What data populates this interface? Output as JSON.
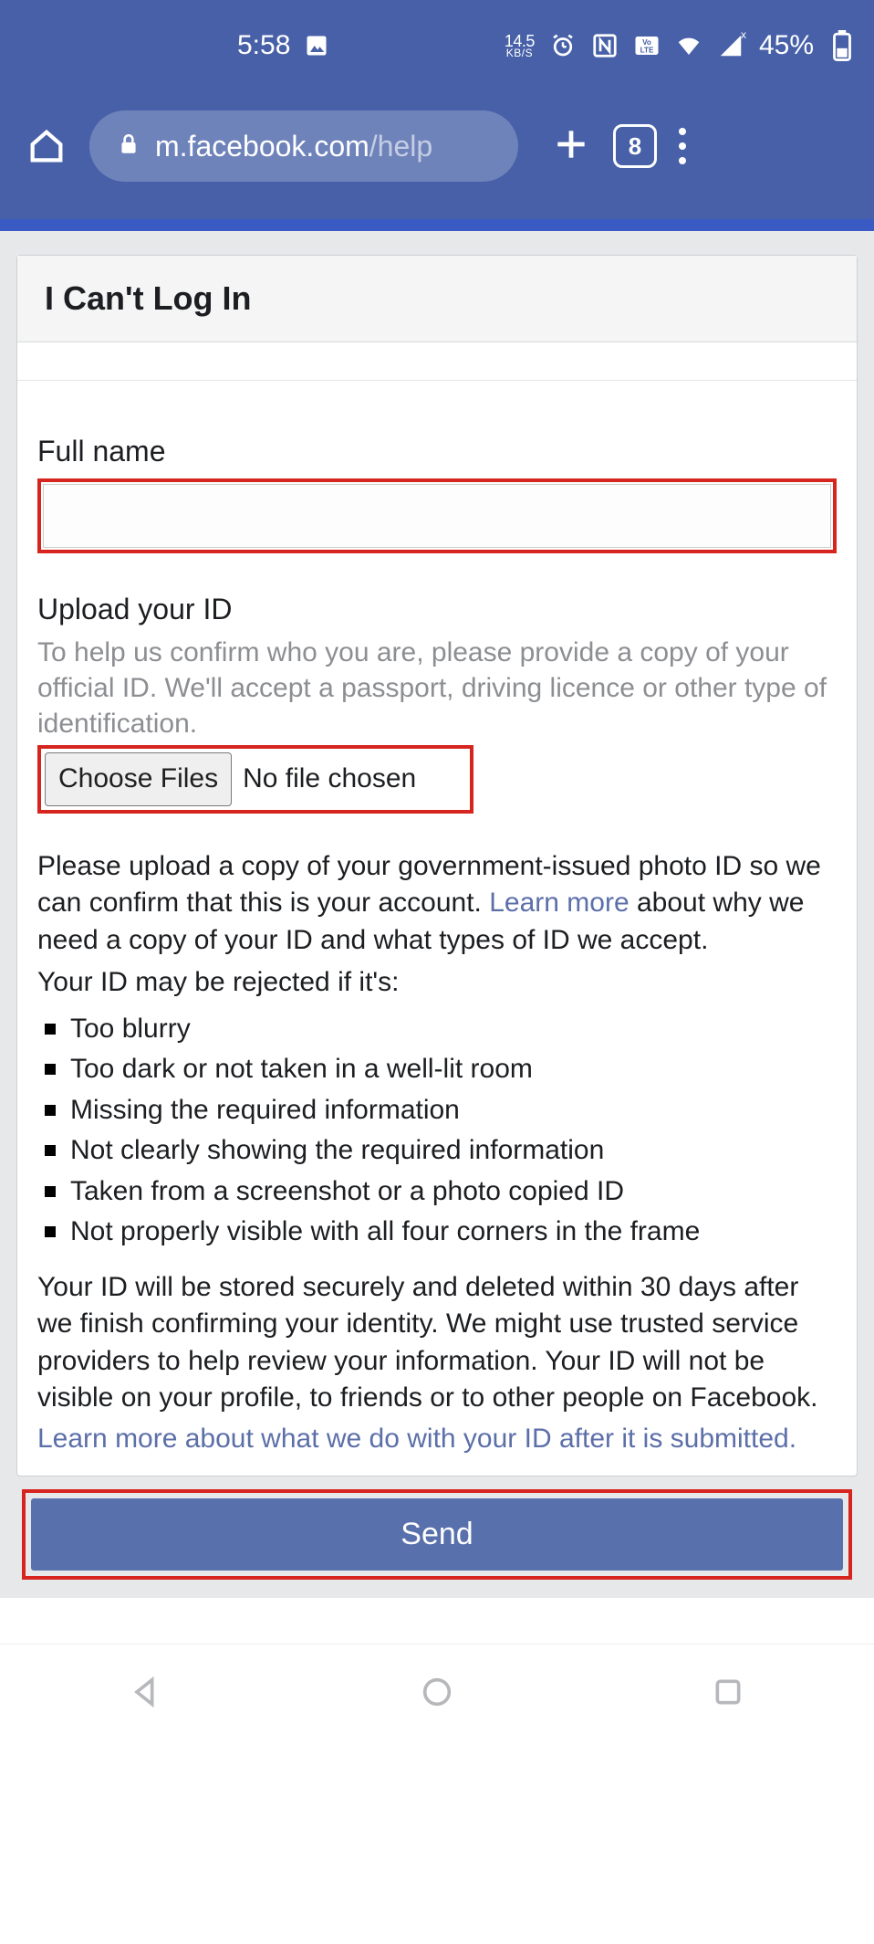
{
  "statusbar": {
    "time": "5:58",
    "data_rate_top": "14.5",
    "data_rate_bot": "KB/S",
    "battery_pct": "45%"
  },
  "browser": {
    "url_main": "m.facebook.com",
    "url_path": "/help",
    "tab_count": "8"
  },
  "page": {
    "title": "I Can't Log In",
    "fullname_label": "Full name",
    "upload_label": "Upload your ID",
    "upload_hint": "To help us confirm who you are, please provide a copy of your official ID. We'll accept a passport, driving licence or other type of identification.",
    "choose_files": "Choose Files",
    "no_file": "No file chosen",
    "para1_a": "Please upload a copy of your government-issued photo ID so we can confirm that this is your account. ",
    "learn_more": "Learn more",
    "para1_b": " about why we need a copy of your ID and what types of ID we accept.",
    "reject_intro": "Your ID may be rejected if it's:",
    "reject_list": [
      "Too blurry",
      "Too dark or not taken in a well-lit room",
      "Missing the required information",
      "Not clearly showing the required information",
      "Taken from a screenshot or a photo copied ID",
      "Not properly visible with all four corners in the frame"
    ],
    "storage_text": "Your ID will be stored securely and deleted within 30 days after we finish confirming your identity. We might use trusted service providers to help review your information. Your ID will not be visible on your profile, to friends or to other people on Facebook.",
    "learn_more2": "Learn more about what we do with your ID after it is submitted.",
    "send": "Send"
  }
}
